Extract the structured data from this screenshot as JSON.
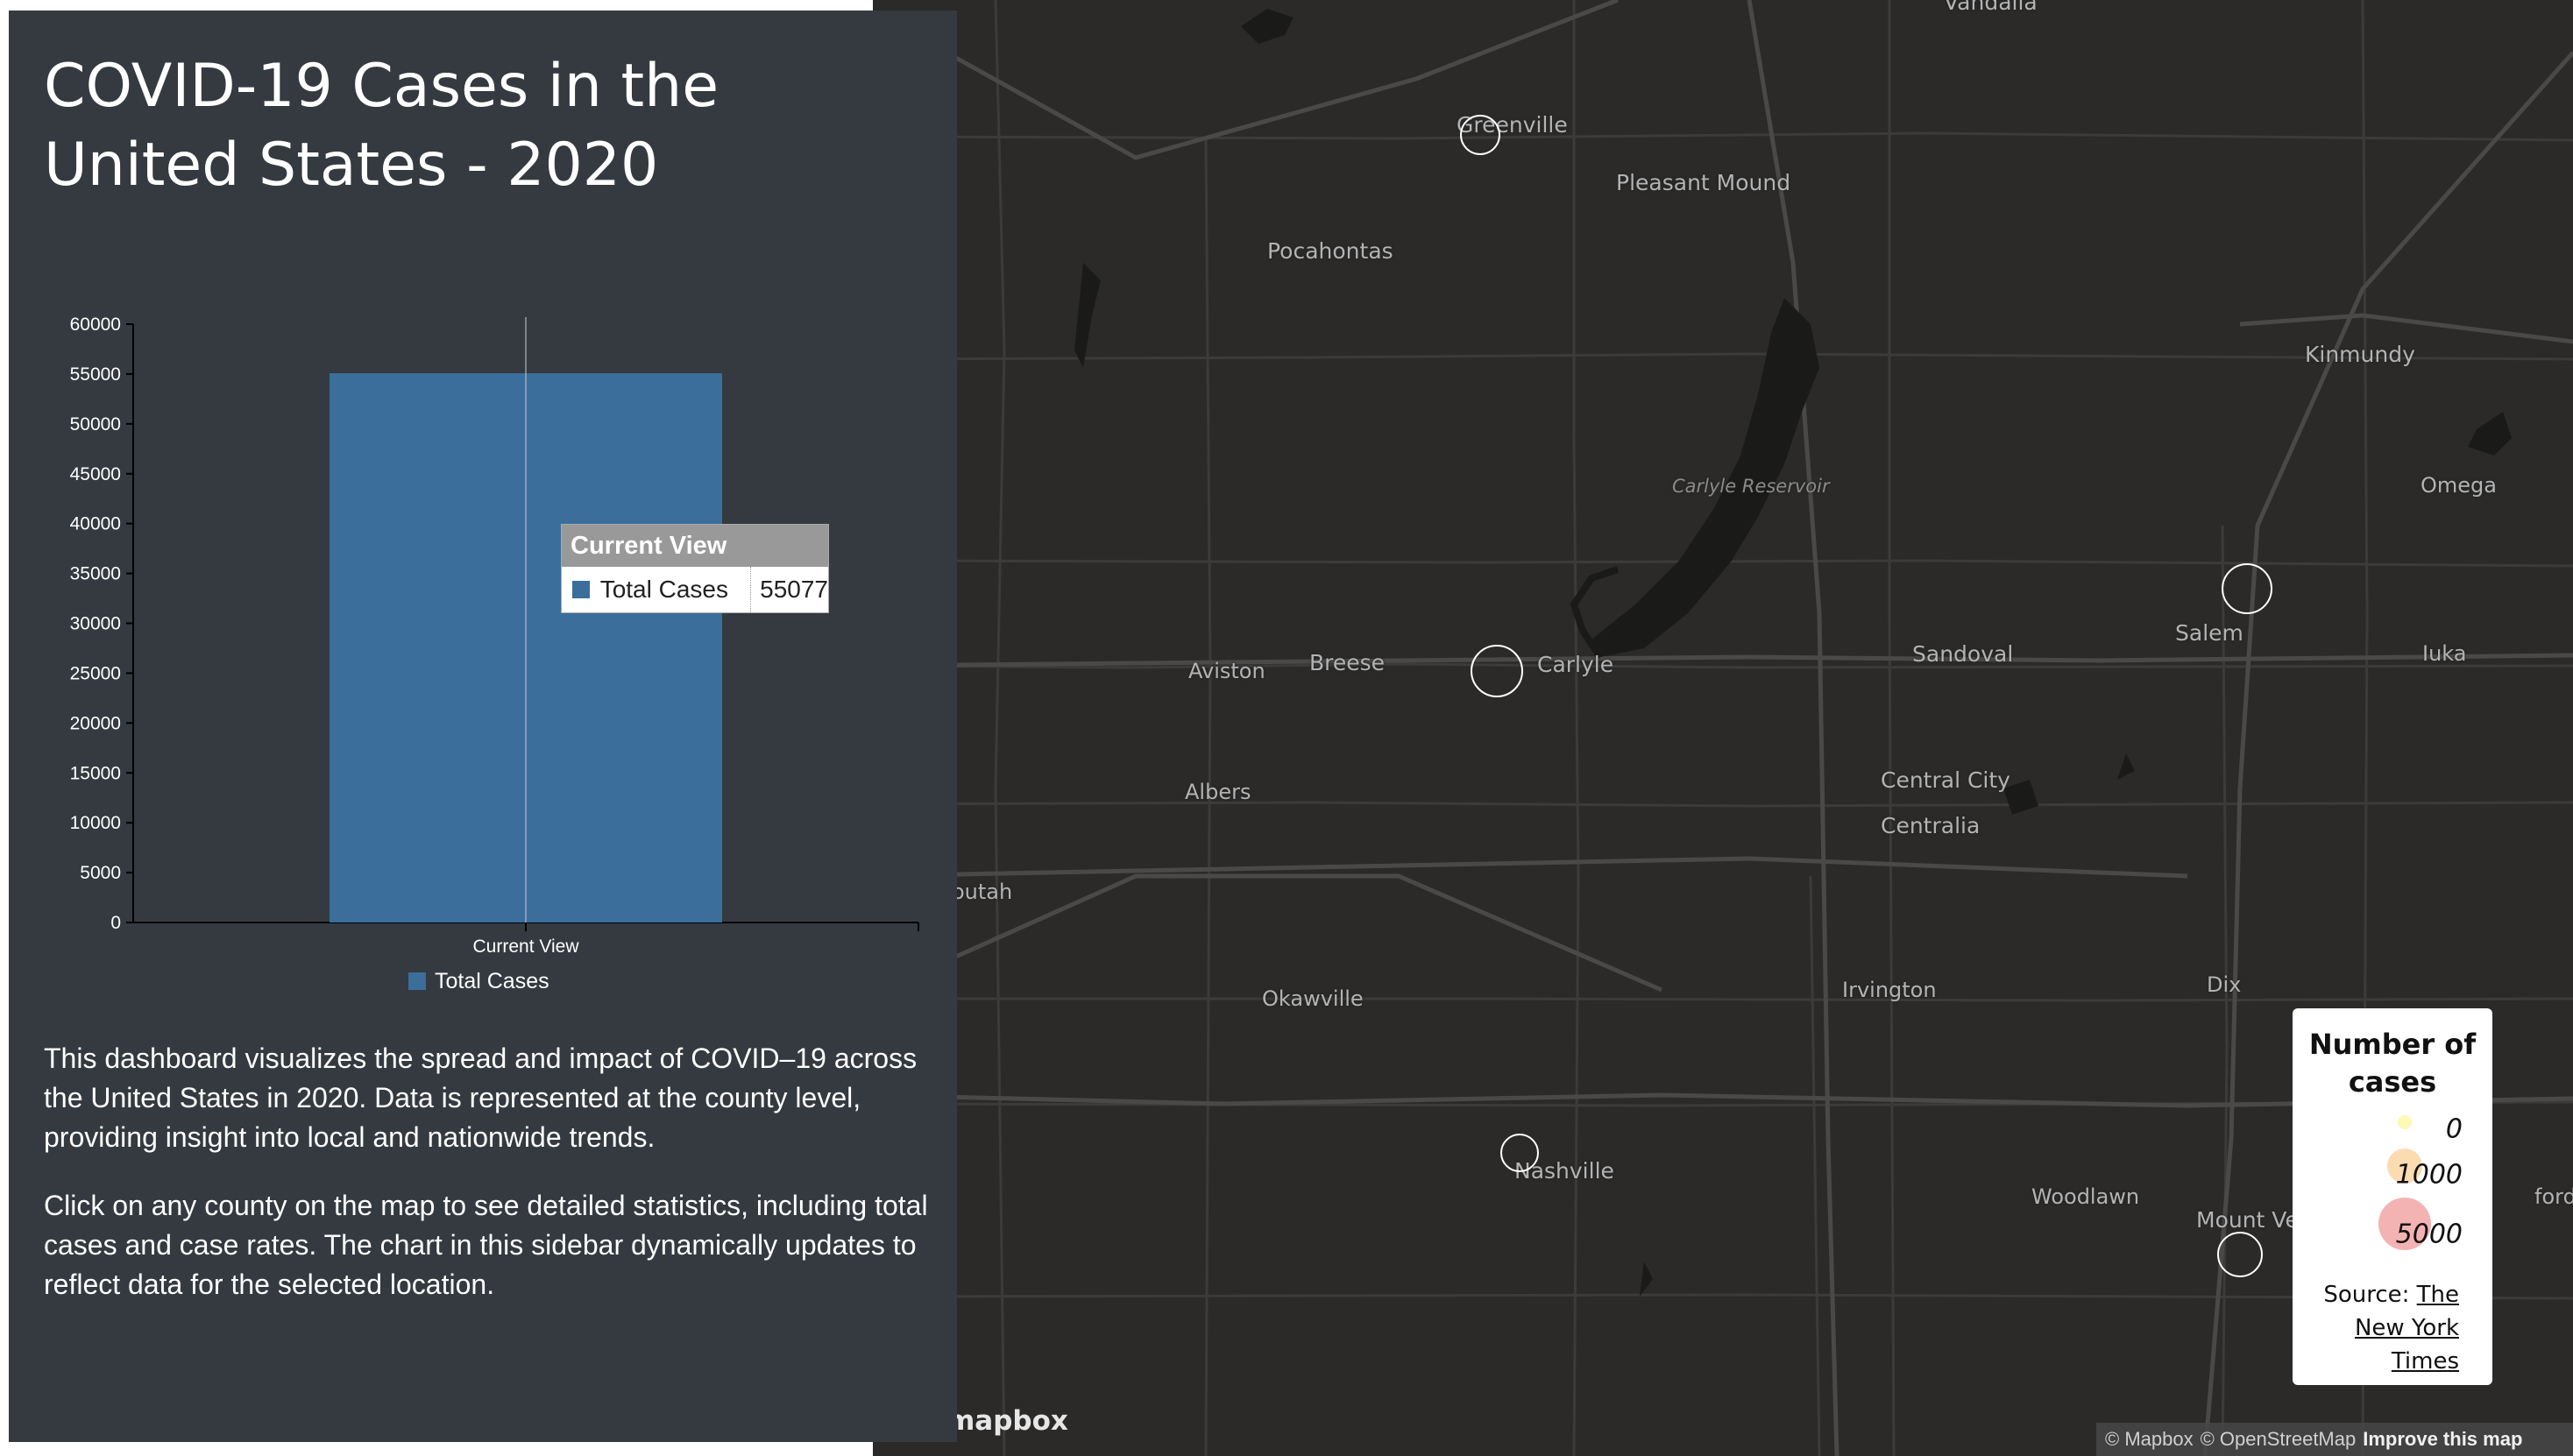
{
  "sidebar": {
    "title": "COVID-19 Cases in the United States - 2020",
    "description_1": "This dashboard visualizes the spread and impact of COVID–19 across the United States in 2020. Data is represented at the county level, providing insight into local and nationwide trends.",
    "description_2": "Click on any county on the map to see detailed statistics, including total cases and case rates. The chart in this sidebar dynamically updates to reflect data for the selected location."
  },
  "chart_data": {
    "type": "bar",
    "categories": [
      "Current View"
    ],
    "series": [
      {
        "name": "Total Cases",
        "values": [
          55077
        ]
      }
    ],
    "ylim": [
      0,
      60000
    ],
    "yticks": [
      0,
      5000,
      10000,
      15000,
      20000,
      25000,
      30000,
      35000,
      40000,
      45000,
      50000,
      55000,
      60000
    ],
    "legend_position": "bottom",
    "bar_color": "#3b6e9b",
    "tooltip": {
      "title": "Current View",
      "label": "Total Cases",
      "value": "55077"
    }
  },
  "map": {
    "places": [
      {
        "id": "vandalia",
        "name": "Vandalia"
      },
      {
        "id": "greenville",
        "name": "Greenville"
      },
      {
        "id": "pleasant-mound",
        "name": "Pleasant Mound"
      },
      {
        "id": "pocahontas",
        "name": "Pocahontas"
      },
      {
        "id": "kinmundy",
        "name": "Kinmundy"
      },
      {
        "id": "omega",
        "name": "Omega"
      },
      {
        "id": "carlyle-reservoir",
        "name": "Carlyle Reservoir"
      },
      {
        "id": "salem",
        "name": "Salem"
      },
      {
        "id": "iuka",
        "name": "Iuka"
      },
      {
        "id": "aviston",
        "name": "Aviston"
      },
      {
        "id": "breese",
        "name": "Breese"
      },
      {
        "id": "carlyle",
        "name": "Carlyle"
      },
      {
        "id": "sandoval",
        "name": "Sandoval"
      },
      {
        "id": "central-city",
        "name": "Central City"
      },
      {
        "id": "centralia",
        "name": "Centralia"
      },
      {
        "id": "albers",
        "name": "Albers"
      },
      {
        "id": "mascoutah",
        "name": "outah"
      },
      {
        "id": "okawville",
        "name": "Okawville"
      },
      {
        "id": "irvington",
        "name": "Irvington"
      },
      {
        "id": "dix",
        "name": "Dix"
      },
      {
        "id": "nashville",
        "name": "Nashville"
      },
      {
        "id": "woodlawn",
        "name": "Woodlawn"
      },
      {
        "id": "mount-vernon",
        "name": "Mount Ve"
      },
      {
        "id": "bluford",
        "name": "ford"
      }
    ],
    "markers": [
      {
        "id": "greenville",
        "color": "#7a5027"
      },
      {
        "id": "carlyle",
        "color": "#6b2820"
      },
      {
        "id": "salem",
        "color": "#6e3422"
      },
      {
        "id": "nashville",
        "color": "#7c5a2e"
      },
      {
        "id": "mount-vernon",
        "color": "#6e3a24"
      }
    ],
    "logo": "mapbox",
    "attribution": {
      "mapbox": "© Mapbox",
      "osm": "© OpenStreetMap",
      "improve": "Improve this map"
    }
  },
  "legend": {
    "title": "Number of cases",
    "items": [
      {
        "label": "0",
        "color": "#fef9b3"
      },
      {
        "label": "1000",
        "color": "#fbdcb0"
      },
      {
        "label": "5000",
        "color": "#f4b3b3"
      }
    ],
    "source_prefix": "Source:",
    "source_link": "The New York Times"
  }
}
